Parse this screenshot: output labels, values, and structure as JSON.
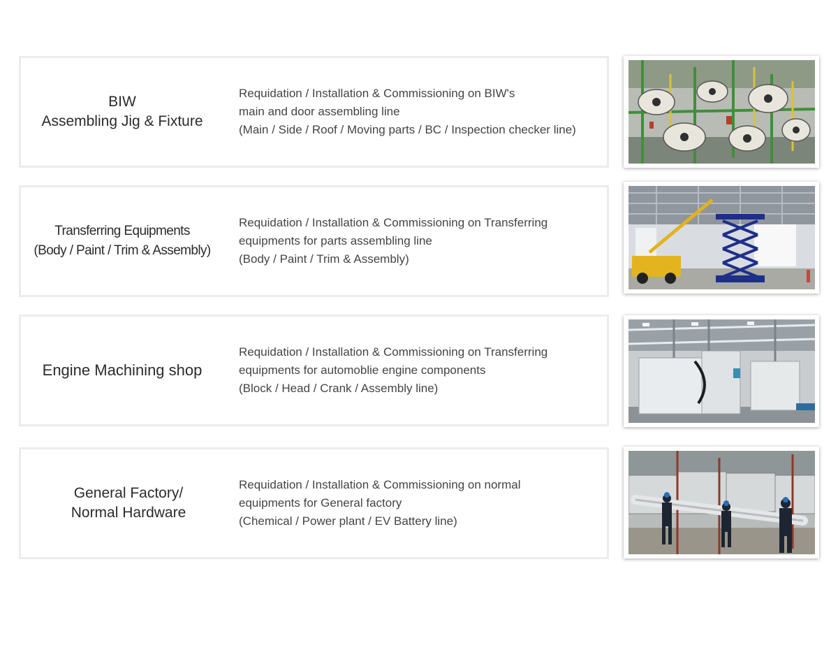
{
  "services": [
    {
      "title_lines": [
        "BIW",
        "Assembling Jig & Fixture"
      ],
      "desc_lines": [
        "Requidation / Installation & Commissioning on BIW's",
        "main and door assembling line",
        "(Main / Side / Roof / Moving parts / BC / Inspection checker line)"
      ],
      "photo": "biw-robot-welding-line-photo"
    },
    {
      "title_lines": [
        "Transferring Equipments",
        "(Body / Paint / Trim & Assembly)"
      ],
      "desc_lines": [
        "Requidation / Installation & Commissioning on Transferring",
        "equipments for parts assembling line",
        "(Body / Paint / Trim & Assembly)"
      ],
      "photo": "factory-hall-scissor-lift-crane-photo"
    },
    {
      "title_lines": [
        "Engine Machining shop"
      ],
      "desc_lines": [
        "Requidation / Installation & Commissioning on Transferring",
        "equipments for automoblie engine components",
        "(Block / Head / Crank / Assembly line)"
      ],
      "photo": "engine-machining-center-photo"
    },
    {
      "title_lines": [
        "General Factory/",
        "Normal Hardware"
      ],
      "desc_lines": [
        "Requidation / Installation & Commissioning on normal",
        "equipments for General factory",
        "(Chemical / Power plant / EV Battery line)"
      ],
      "photo": "workers-installing-pipe-photo"
    }
  ]
}
